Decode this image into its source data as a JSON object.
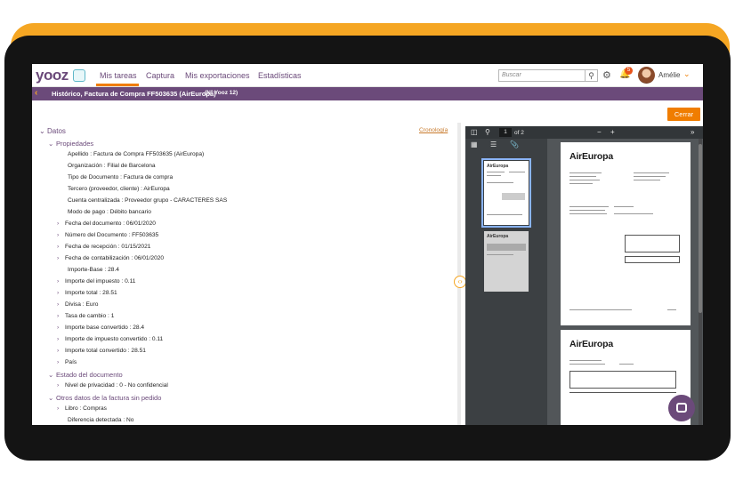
{
  "nav": {
    "logo": "yooz",
    "tabs": [
      "Mis tareas",
      "Captura",
      "Mis exportaciones",
      "Estadísticas"
    ],
    "search_placeholder": "Buscar",
    "notification_count": "5",
    "user_name": "Amélie"
  },
  "header": {
    "title": "Histórico, Factura de Compra FF503635 (AirEuropa)",
    "subtitle": "(Nº Yooz 12)",
    "close_label": "Cerrar"
  },
  "details": {
    "cronologia": "Cronología",
    "root": "Datos",
    "propiedades": "Propiedades",
    "fields": [
      {
        "label": "Apellido",
        "value": "Factura de Compra FF503635 (AirEuropa)"
      },
      {
        "label": "Organización",
        "value": "Filial de Barcelona"
      },
      {
        "label": "Tipo de Documento",
        "value": "Factura de compra"
      },
      {
        "label": "Tercero (proveedor, cliente)",
        "value": "AirEuropa"
      },
      {
        "label": "Cuenta centralizada",
        "value": "Proveedor grupo - CARACTERES SAS"
      },
      {
        "label": "Modo de pago",
        "value": "Débito bancario"
      }
    ],
    "expandable": [
      {
        "label": "Fecha del documento",
        "value": "06/01/2020"
      },
      {
        "label": "Número del Documento",
        "value": "FF503635"
      },
      {
        "label": "Fecha de recepción",
        "value": "01/15/2021"
      },
      {
        "label": "Fecha de contabilización",
        "value": "06/01/2020"
      },
      {
        "label": "Importe-Base",
        "value": "28.4"
      },
      {
        "label": "Importe del impuesto",
        "value": "0.11"
      },
      {
        "label": "Importe total",
        "value": "28.51"
      },
      {
        "label": "Divisa",
        "value": "Euro"
      },
      {
        "label": "Tasa de cambio",
        "value": "1"
      },
      {
        "label": "Importe base convertido",
        "value": "28.4"
      },
      {
        "label": "Importe de impuesto convertido",
        "value": "0.11"
      },
      {
        "label": "Importe total convertido",
        "value": "28.51"
      },
      {
        "label": "País",
        "value": ""
      }
    ],
    "estado": "Estado del documento",
    "privacidad": {
      "label": "Nivel de privacidad",
      "value": "0 - No confidencial"
    },
    "otros": "Otros datos de la factura sin pedido",
    "libro": {
      "label": "Libro",
      "value": "Compras"
    },
    "diferencia": {
      "label": "Diferencia detectada",
      "value": "No"
    }
  },
  "viewer": {
    "page_current": "1",
    "page_total": "of 2",
    "brand": "AirEuropa",
    "thumb_brand": "AirEuropa"
  }
}
